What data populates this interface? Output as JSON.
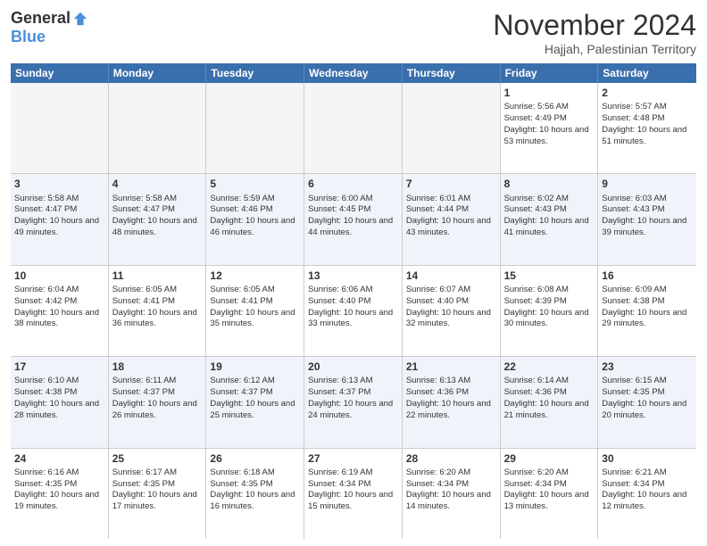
{
  "header": {
    "logo_general": "General",
    "logo_blue": "Blue",
    "month_title": "November 2024",
    "location": "Hajjah, Palestinian Territory"
  },
  "days_of_week": [
    "Sunday",
    "Monday",
    "Tuesday",
    "Wednesday",
    "Thursday",
    "Friday",
    "Saturday"
  ],
  "weeks": [
    [
      {
        "day": "",
        "info": ""
      },
      {
        "day": "",
        "info": ""
      },
      {
        "day": "",
        "info": ""
      },
      {
        "day": "",
        "info": ""
      },
      {
        "day": "",
        "info": ""
      },
      {
        "day": "1",
        "sunrise": "Sunrise: 5:56 AM",
        "sunset": "Sunset: 4:49 PM",
        "daylight": "Daylight: 10 hours and 53 minutes."
      },
      {
        "day": "2",
        "sunrise": "Sunrise: 5:57 AM",
        "sunset": "Sunset: 4:48 PM",
        "daylight": "Daylight: 10 hours and 51 minutes."
      }
    ],
    [
      {
        "day": "3",
        "sunrise": "Sunrise: 5:58 AM",
        "sunset": "Sunset: 4:47 PM",
        "daylight": "Daylight: 10 hours and 49 minutes."
      },
      {
        "day": "4",
        "sunrise": "Sunrise: 5:58 AM",
        "sunset": "Sunset: 4:47 PM",
        "daylight": "Daylight: 10 hours and 48 minutes."
      },
      {
        "day": "5",
        "sunrise": "Sunrise: 5:59 AM",
        "sunset": "Sunset: 4:46 PM",
        "daylight": "Daylight: 10 hours and 46 minutes."
      },
      {
        "day": "6",
        "sunrise": "Sunrise: 6:00 AM",
        "sunset": "Sunset: 4:45 PM",
        "daylight": "Daylight: 10 hours and 44 minutes."
      },
      {
        "day": "7",
        "sunrise": "Sunrise: 6:01 AM",
        "sunset": "Sunset: 4:44 PM",
        "daylight": "Daylight: 10 hours and 43 minutes."
      },
      {
        "day": "8",
        "sunrise": "Sunrise: 6:02 AM",
        "sunset": "Sunset: 4:43 PM",
        "daylight": "Daylight: 10 hours and 41 minutes."
      },
      {
        "day": "9",
        "sunrise": "Sunrise: 6:03 AM",
        "sunset": "Sunset: 4:43 PM",
        "daylight": "Daylight: 10 hours and 39 minutes."
      }
    ],
    [
      {
        "day": "10",
        "sunrise": "Sunrise: 6:04 AM",
        "sunset": "Sunset: 4:42 PM",
        "daylight": "Daylight: 10 hours and 38 minutes."
      },
      {
        "day": "11",
        "sunrise": "Sunrise: 6:05 AM",
        "sunset": "Sunset: 4:41 PM",
        "daylight": "Daylight: 10 hours and 36 minutes."
      },
      {
        "day": "12",
        "sunrise": "Sunrise: 6:05 AM",
        "sunset": "Sunset: 4:41 PM",
        "daylight": "Daylight: 10 hours and 35 minutes."
      },
      {
        "day": "13",
        "sunrise": "Sunrise: 6:06 AM",
        "sunset": "Sunset: 4:40 PM",
        "daylight": "Daylight: 10 hours and 33 minutes."
      },
      {
        "day": "14",
        "sunrise": "Sunrise: 6:07 AM",
        "sunset": "Sunset: 4:40 PM",
        "daylight": "Daylight: 10 hours and 32 minutes."
      },
      {
        "day": "15",
        "sunrise": "Sunrise: 6:08 AM",
        "sunset": "Sunset: 4:39 PM",
        "daylight": "Daylight: 10 hours and 30 minutes."
      },
      {
        "day": "16",
        "sunrise": "Sunrise: 6:09 AM",
        "sunset": "Sunset: 4:38 PM",
        "daylight": "Daylight: 10 hours and 29 minutes."
      }
    ],
    [
      {
        "day": "17",
        "sunrise": "Sunrise: 6:10 AM",
        "sunset": "Sunset: 4:38 PM",
        "daylight": "Daylight: 10 hours and 28 minutes."
      },
      {
        "day": "18",
        "sunrise": "Sunrise: 6:11 AM",
        "sunset": "Sunset: 4:37 PM",
        "daylight": "Daylight: 10 hours and 26 minutes."
      },
      {
        "day": "19",
        "sunrise": "Sunrise: 6:12 AM",
        "sunset": "Sunset: 4:37 PM",
        "daylight": "Daylight: 10 hours and 25 minutes."
      },
      {
        "day": "20",
        "sunrise": "Sunrise: 6:13 AM",
        "sunset": "Sunset: 4:37 PM",
        "daylight": "Daylight: 10 hours and 24 minutes."
      },
      {
        "day": "21",
        "sunrise": "Sunrise: 6:13 AM",
        "sunset": "Sunset: 4:36 PM",
        "daylight": "Daylight: 10 hours and 22 minutes."
      },
      {
        "day": "22",
        "sunrise": "Sunrise: 6:14 AM",
        "sunset": "Sunset: 4:36 PM",
        "daylight": "Daylight: 10 hours and 21 minutes."
      },
      {
        "day": "23",
        "sunrise": "Sunrise: 6:15 AM",
        "sunset": "Sunset: 4:35 PM",
        "daylight": "Daylight: 10 hours and 20 minutes."
      }
    ],
    [
      {
        "day": "24",
        "sunrise": "Sunrise: 6:16 AM",
        "sunset": "Sunset: 4:35 PM",
        "daylight": "Daylight: 10 hours and 19 minutes."
      },
      {
        "day": "25",
        "sunrise": "Sunrise: 6:17 AM",
        "sunset": "Sunset: 4:35 PM",
        "daylight": "Daylight: 10 hours and 17 minutes."
      },
      {
        "day": "26",
        "sunrise": "Sunrise: 6:18 AM",
        "sunset": "Sunset: 4:35 PM",
        "daylight": "Daylight: 10 hours and 16 minutes."
      },
      {
        "day": "27",
        "sunrise": "Sunrise: 6:19 AM",
        "sunset": "Sunset: 4:34 PM",
        "daylight": "Daylight: 10 hours and 15 minutes."
      },
      {
        "day": "28",
        "sunrise": "Sunrise: 6:20 AM",
        "sunset": "Sunset: 4:34 PM",
        "daylight": "Daylight: 10 hours and 14 minutes."
      },
      {
        "day": "29",
        "sunrise": "Sunrise: 6:20 AM",
        "sunset": "Sunset: 4:34 PM",
        "daylight": "Daylight: 10 hours and 13 minutes."
      },
      {
        "day": "30",
        "sunrise": "Sunrise: 6:21 AM",
        "sunset": "Sunset: 4:34 PM",
        "daylight": "Daylight: 10 hours and 12 minutes."
      }
    ]
  ]
}
